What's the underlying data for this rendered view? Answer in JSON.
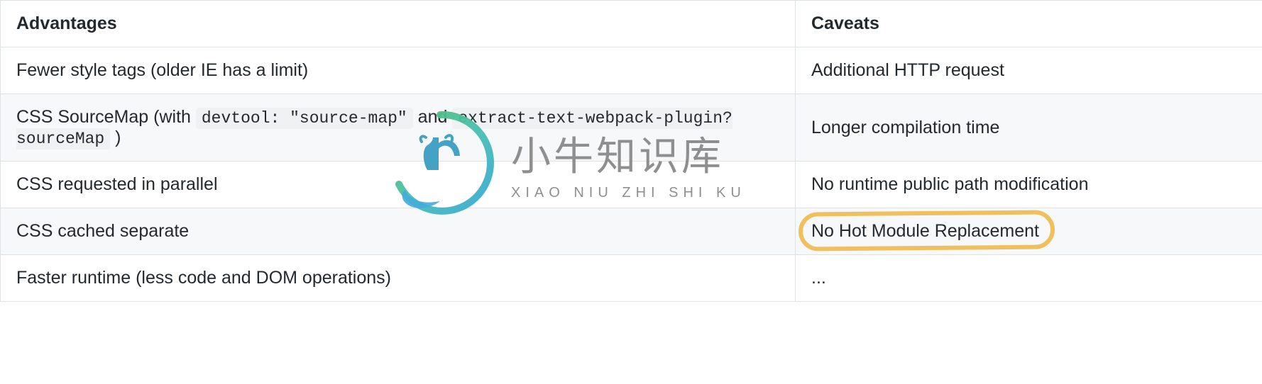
{
  "table": {
    "headers": {
      "advantages": "Advantages",
      "caveats": "Caveats"
    },
    "rows": [
      {
        "advantage_text": "Fewer style tags (older IE has a limit)",
        "caveat_text": "Additional HTTP request"
      },
      {
        "advantage_prefix": "CSS SourceMap (with ",
        "advantage_code1": "devtool: \"source-map\"",
        "advantage_mid": " and ",
        "advantage_code2": "extract-text-webpack-plugin?sourceMap",
        "advantage_suffix": " )",
        "caveat_text": "Longer compilation time"
      },
      {
        "advantage_text": "CSS requested in parallel",
        "caveat_text": "No runtime public path modification"
      },
      {
        "advantage_text": "CSS cached separate",
        "caveat_text": "No Hot Module Replacement"
      },
      {
        "advantage_text": "Faster runtime (less code and DOM operations)",
        "caveat_text": "..."
      }
    ]
  },
  "watermark": {
    "cn": "小牛知识库",
    "en": "XIAO NIU ZHI SHI KU"
  }
}
